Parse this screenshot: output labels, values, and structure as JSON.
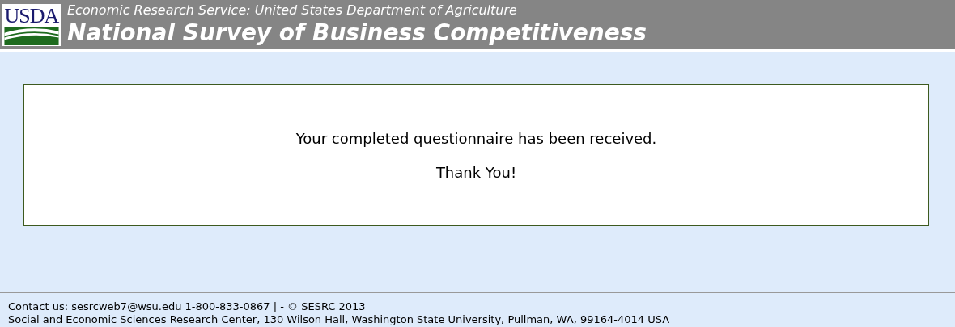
{
  "header": {
    "logo_text": "USDA",
    "agency": "Economic Research Service: United States Department of Agriculture",
    "title": "National Survey of Business Competitiveness"
  },
  "message": {
    "lines": [
      "Your completed questionnaire has been received.",
      "Thank You!"
    ]
  },
  "footer": {
    "contact": "Contact us: sesrcweb7@wsu.edu 1-800-833-0867 | - © SESRC 2013",
    "address": "Social and Economic Sciences Research Center, 130 Wilson Hall, Washington State University, Pullman, WA, 99164-4014 USA"
  }
}
